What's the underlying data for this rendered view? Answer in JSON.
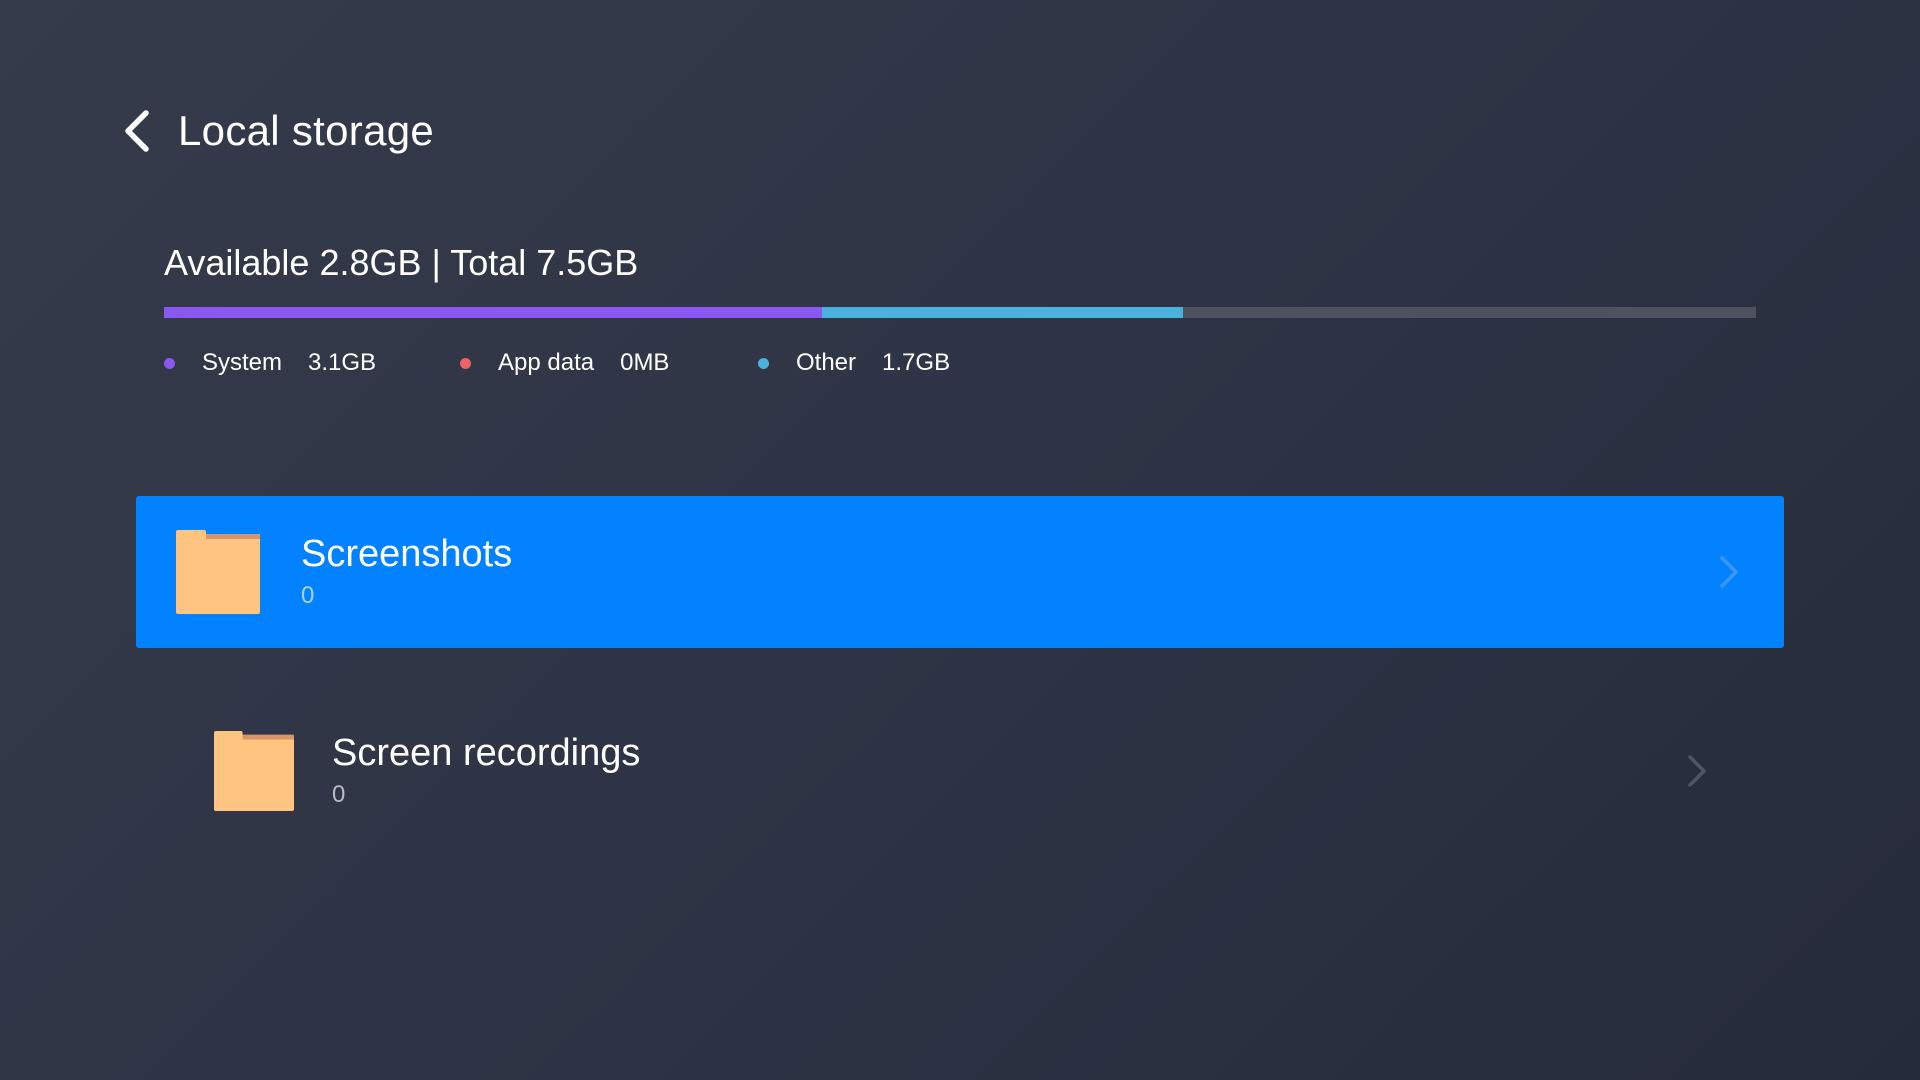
{
  "header": {
    "title": "Local storage",
    "back_icon": "chevron-left-icon"
  },
  "storage": {
    "summary": "Available 2.8GB | Total 7.5GB",
    "total_gb": 7.5,
    "available_gb": 2.8,
    "segments": [
      {
        "name": "System",
        "value": "3.1GB",
        "gb": 3.1,
        "color": "#8a57f2"
      },
      {
        "name": "App data",
        "value": "0MB",
        "gb": 0.0,
        "color": "#ec6464"
      },
      {
        "name": "Other",
        "value": "1.7GB",
        "gb": 1.7,
        "color": "#4bb1dd"
      }
    ],
    "track_color": "#4d525e"
  },
  "folders": [
    {
      "name": "Screenshots",
      "count": "0",
      "focused": true,
      "icon": "folder-icon",
      "arrow_icon": "chevron-right-icon"
    },
    {
      "name": "Screen recordings",
      "count": "0",
      "focused": false,
      "icon": "folder-icon",
      "arrow_icon": "chevron-right-icon"
    }
  ],
  "colors": {
    "focus_highlight": "#0382ff",
    "folder": "#ffc47f",
    "folder_tab": "#d9956a"
  }
}
